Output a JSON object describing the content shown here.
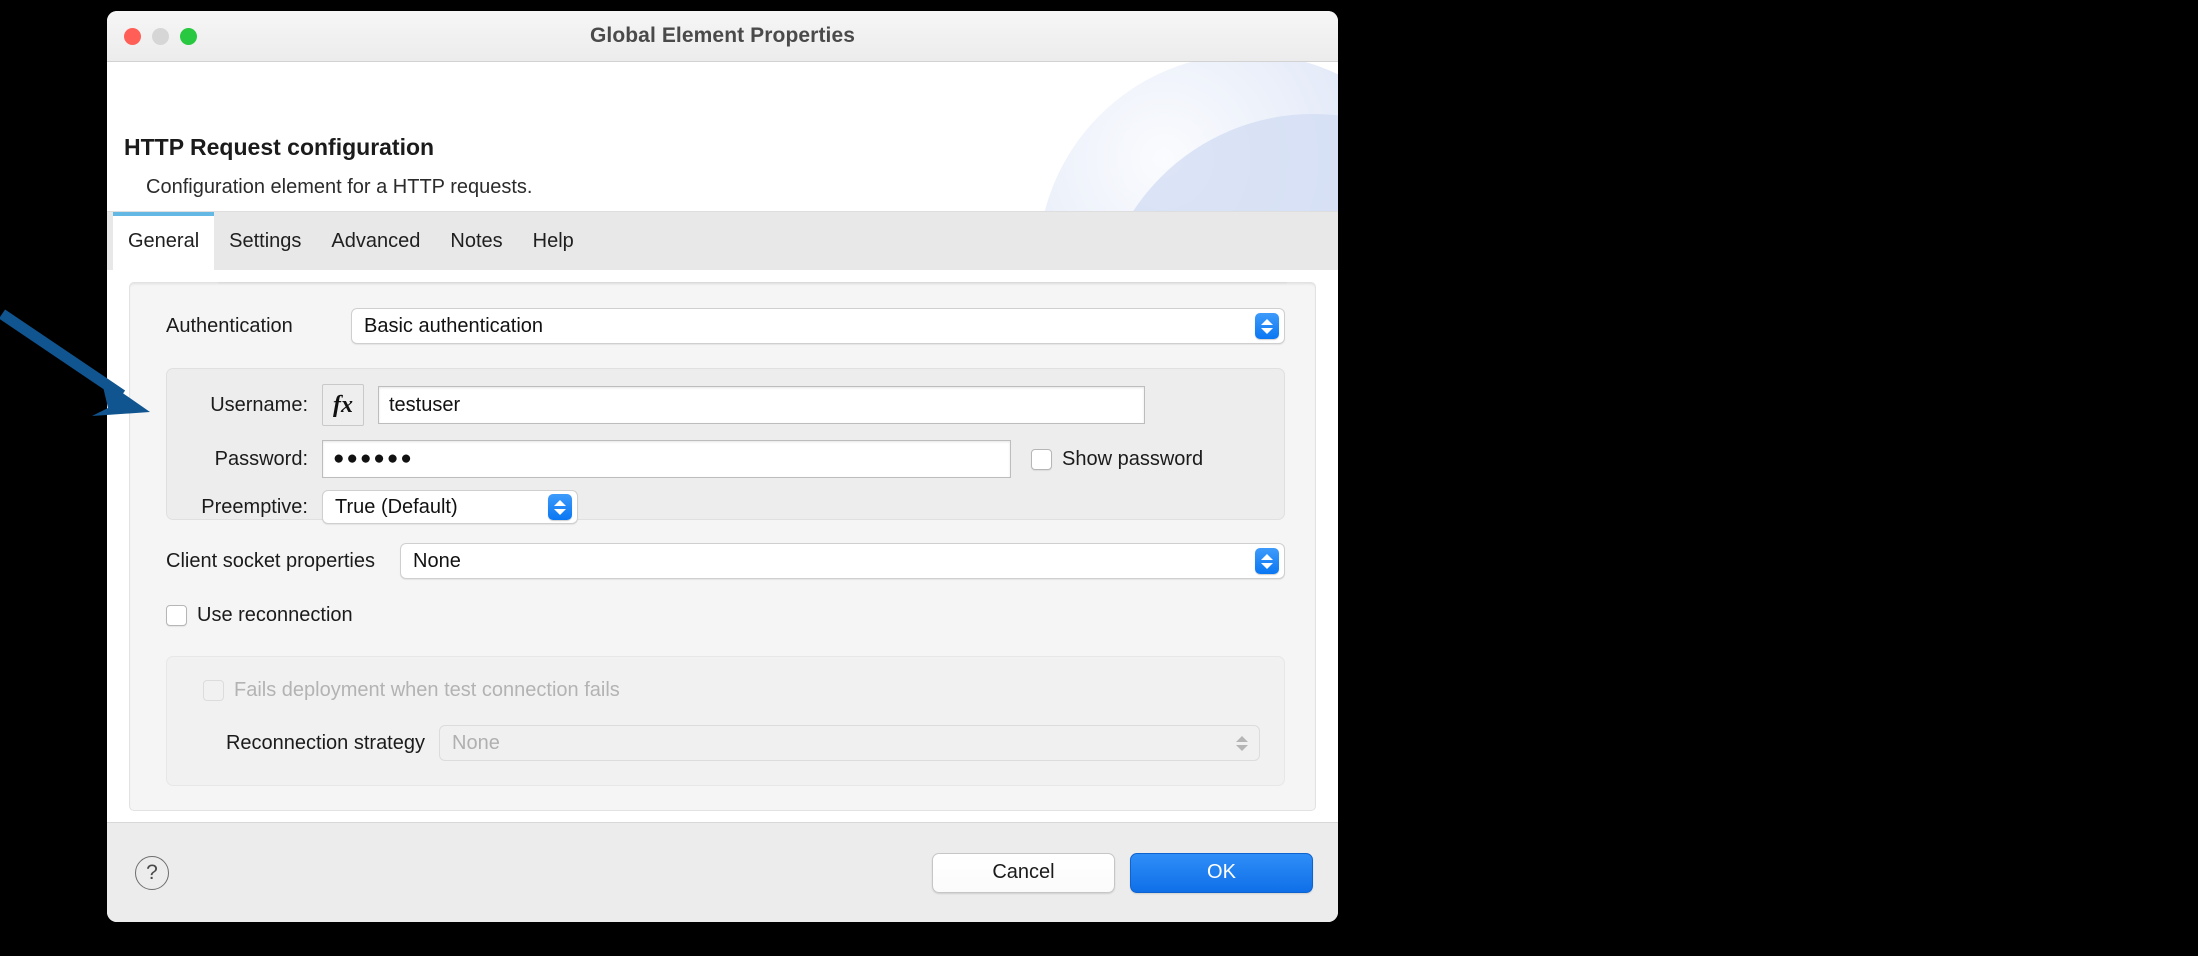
{
  "window": {
    "title": "Global Element Properties",
    "traffic_lights": [
      "close-red",
      "minimize-yellow",
      "maximize-green"
    ]
  },
  "header": {
    "title": "HTTP Request configuration",
    "subtitle": "Configuration element for a HTTP requests."
  },
  "tabs": [
    {
      "label": "General",
      "active": true
    },
    {
      "label": "Settings",
      "active": false
    },
    {
      "label": "Advanced",
      "active": false
    },
    {
      "label": "Notes",
      "active": false
    },
    {
      "label": "Help",
      "active": false
    }
  ],
  "form": {
    "authentication": {
      "label": "Authentication",
      "value": "Basic authentication"
    },
    "username": {
      "label": "Username:",
      "fx_label": "fx",
      "value": "testuser"
    },
    "password": {
      "label": "Password:",
      "value": "●●●●●●",
      "show_password_label": "Show password",
      "show_password_checked": false
    },
    "preemptive": {
      "label": "Preemptive:",
      "value": "True (Default)"
    },
    "client_socket_properties": {
      "label": "Client socket properties",
      "value": "None"
    },
    "use_reconnection": {
      "label": "Use reconnection",
      "checked": false
    },
    "fails_deployment": {
      "label": "Fails deployment when test connection fails",
      "checked": false,
      "disabled": true
    },
    "reconnection_strategy": {
      "label": "Reconnection strategy",
      "value": "None",
      "disabled": true
    }
  },
  "footer": {
    "help_label": "?",
    "cancel_label": "Cancel",
    "ok_label": "OK"
  },
  "annotation": {
    "arrow_color": "#10558f",
    "points_to": "username-row"
  },
  "colors": {
    "accent_blue": "#0f6fe8",
    "tab_active_underline": "#63b9e3",
    "stepper_blue": "#0a77f2",
    "close_red": "#ff5f57",
    "minimize_gray": "#d6d6d6",
    "maximize_green": "#28c840",
    "window_bg": "#ffffff",
    "panel_bg": "#f5f5f5",
    "page_bg": "#000000"
  }
}
